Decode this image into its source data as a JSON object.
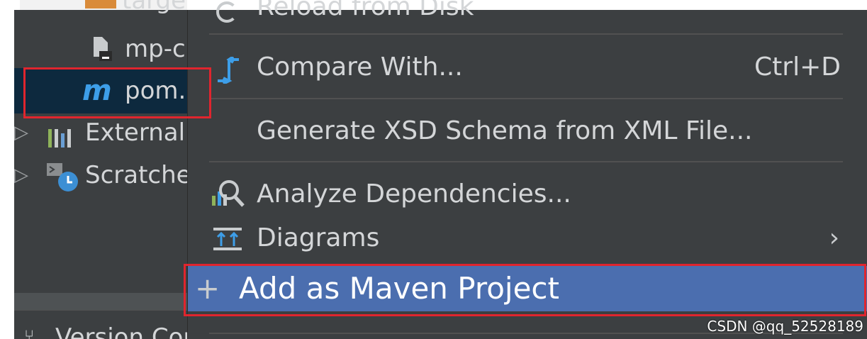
{
  "project_tree": {
    "top_partial_label": "targe",
    "items": [
      {
        "label": "mp-c",
        "icon": "file-icon"
      },
      {
        "label": "pom.",
        "icon": "maven-m-icon",
        "selected": true
      },
      {
        "label": "External",
        "icon": "library-icon"
      },
      {
        "label": "Scratche",
        "icon": "scratch-icon"
      }
    ],
    "bottom_tab_label": "Version Cor"
  },
  "context_menu": {
    "top_partial_label": "Reload from Disk",
    "items": [
      {
        "label": "Compare With...",
        "shortcut": "Ctrl+D",
        "icon": "compare-icon"
      },
      {
        "label": "Generate XSD Schema from XML File...",
        "icon": ""
      },
      {
        "label": "Analyze Dependencies...",
        "icon": "analyze-dependencies-icon"
      },
      {
        "label": "Diagrams",
        "icon": "diagrams-icon",
        "submenu": true
      },
      {
        "label": "Add as Maven Project",
        "icon": "plus-icon",
        "highlighted": true
      }
    ]
  },
  "watermark": "CSDN @qq_52528189",
  "colors": {
    "panel_bg": "#3c3f41",
    "selection_bg": "#0d293e",
    "highlight_bg": "#4b6eaf",
    "annotation_red": "#e0252e"
  }
}
